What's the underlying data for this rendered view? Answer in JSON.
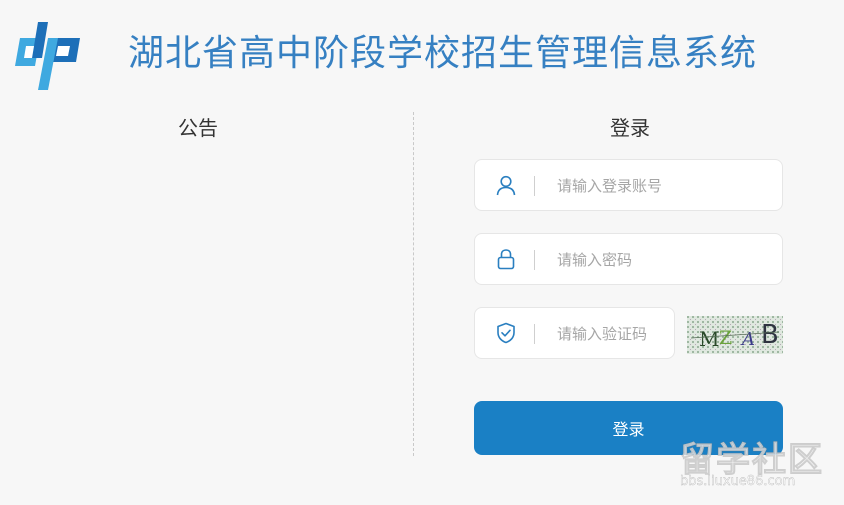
{
  "header": {
    "title": "湖北省高中阶段学校招生管理信息系统"
  },
  "notice": {
    "title": "公告"
  },
  "login": {
    "title": "登录",
    "username_placeholder": "请输入登录账号",
    "password_placeholder": "请输入密码",
    "captcha_placeholder": "请输入验证码",
    "captcha_text": "MZAB",
    "submit_label": "登录"
  },
  "watermark": {
    "main": "留学社区",
    "url": "bbs.liuxue86.com"
  },
  "colors": {
    "brand": "#3680c2",
    "button": "#1a80c5",
    "logo_light": "#3fa9e0",
    "logo_dark": "#1d6fb8"
  },
  "icons": [
    "brand-logo-icon",
    "user-icon",
    "lock-icon",
    "shield-check-icon"
  ]
}
